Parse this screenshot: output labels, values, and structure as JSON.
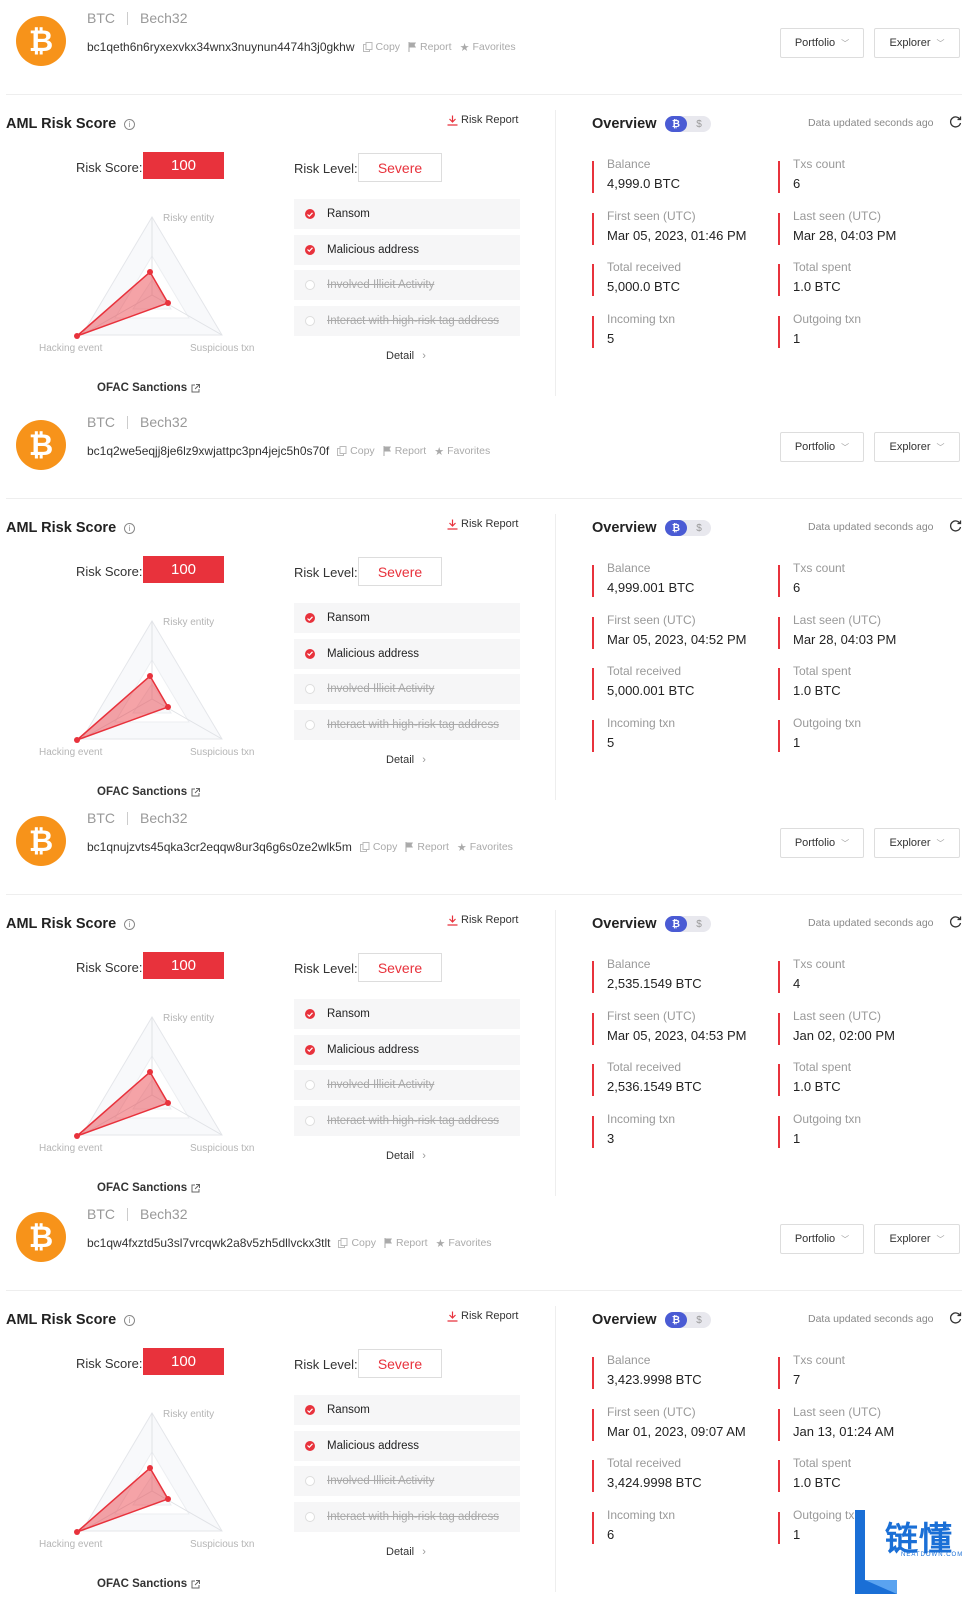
{
  "common": {
    "copy": "Copy",
    "report": "Report",
    "favorites": "Favorites",
    "portfolio": "Portfolio",
    "explorer": "Explorer",
    "aml_title": "AML Risk Score",
    "risk_report": "Risk Report",
    "risk_score_label": "Risk Score:",
    "risk_level_label": "Risk Level:",
    "radar_labels": {
      "top": "Risky entity",
      "left": "Hacking event",
      "right": "Suspicious txn"
    },
    "detail": "Detail",
    "ofac": "OFAC Sanctions",
    "overview": "Overview",
    "badge_btc": "₿",
    "badge_usd": "$",
    "updated": "Data updated seconds ago",
    "stat_labels": {
      "balance": "Balance",
      "txs": "Txs count",
      "first": "First seen (UTC)",
      "last": "Last seen (UTC)",
      "received": "Total received",
      "spent": "Total spent",
      "incoming": "Incoming txn",
      "outgoing": "Outgoing txn"
    },
    "tags": [
      {
        "label": "Ransom",
        "active": true
      },
      {
        "label": "Malicious address",
        "active": true
      },
      {
        "label": "Involved Illicit Activity",
        "active": false
      },
      {
        "label": "Interact with high-risk tag address",
        "active": false
      }
    ]
  },
  "accounts": [
    {
      "chain": "BTC",
      "format": "Bech32",
      "address": "bc1qeth6n6ryxexvkx34wnx3nuynun4474h3j0gkhw",
      "score": "100",
      "level": "Severe",
      "balance": "4,999.0 BTC",
      "txs": "6",
      "first_seen": "Mar 05, 2023, 01:46 PM",
      "last_seen": "Mar 28, 04:03 PM",
      "total_received": "5,000.0 BTC",
      "total_spent": "1.0 BTC",
      "incoming": "5",
      "outgoing": "1"
    },
    {
      "chain": "BTC",
      "format": "Bech32",
      "address": "bc1q2we5eqjj8je6lz9xwjattpc3pn4jejc5h0s70f",
      "score": "100",
      "level": "Severe",
      "balance": "4,999.001 BTC",
      "txs": "6",
      "first_seen": "Mar 05, 2023, 04:52 PM",
      "last_seen": "Mar 28, 04:03 PM",
      "total_received": "5,000.001 BTC",
      "total_spent": "1.0 BTC",
      "incoming": "5",
      "outgoing": "1"
    },
    {
      "chain": "BTC",
      "format": "Bech32",
      "address": "bc1qnujzvts45qka3cr2eqqw8ur3q6g6s0ze2wlk5m",
      "score": "100",
      "level": "Severe",
      "balance": "2,535.1549 BTC",
      "txs": "4",
      "first_seen": "Mar 05, 2023, 04:53 PM",
      "last_seen": "Jan 02, 02:00 PM",
      "total_received": "2,536.1549 BTC",
      "total_spent": "1.0 BTC",
      "incoming": "3",
      "outgoing": "1"
    },
    {
      "chain": "BTC",
      "format": "Bech32",
      "address": "bc1qw4fxztd5u3sl7vrcqwk2a8v5zh5dllvckx3tlt",
      "score": "100",
      "level": "Severe",
      "balance": "3,423.9998 BTC",
      "txs": "7",
      "first_seen": "Mar 01, 2023, 09:07 AM",
      "last_seen": "Jan 13, 01:24 AM",
      "total_received": "3,424.9998 BTC",
      "total_spent": "1.0 BTC",
      "incoming": "6",
      "outgoing": "1"
    }
  ],
  "watermark": {
    "text": "链懂",
    "sub": "NEATDOWN.COM",
    "color": "#1a6fd6"
  }
}
